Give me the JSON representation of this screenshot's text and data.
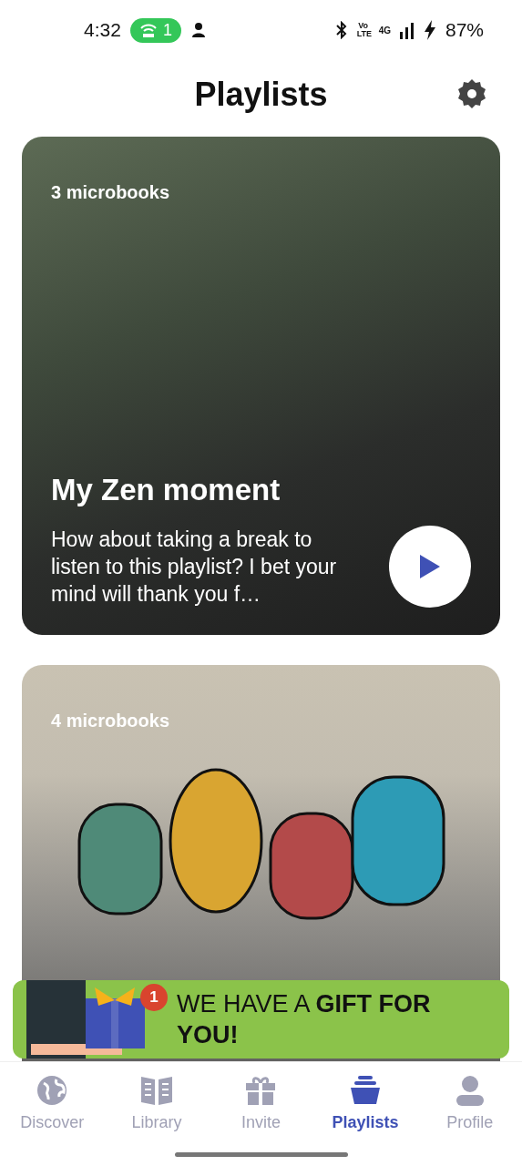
{
  "status_bar": {
    "time": "4:32",
    "hotspot_count": "1",
    "volte": "Vo LTE",
    "network": "4G",
    "battery": "87%"
  },
  "header": {
    "title": "Playlists"
  },
  "playlists": [
    {
      "count": "3 microbooks",
      "title": "My Zen moment",
      "description": "How about taking a break to listen to this playlist? I bet your mind will thank you f…",
      "kind": "photo"
    },
    {
      "count": "4 microbooks",
      "kind": "artwork"
    }
  ],
  "promo_banner": {
    "text": "WE HAVE A **GIFT FOR YOU!**",
    "badge": "1"
  },
  "nav": [
    {
      "label": "Discover",
      "selected": false
    },
    {
      "label": "Library",
      "selected": false
    },
    {
      "label": "Invite",
      "selected": false
    },
    {
      "label": "Playlists",
      "selected": true
    },
    {
      "label": "Profile",
      "selected": false
    }
  ]
}
